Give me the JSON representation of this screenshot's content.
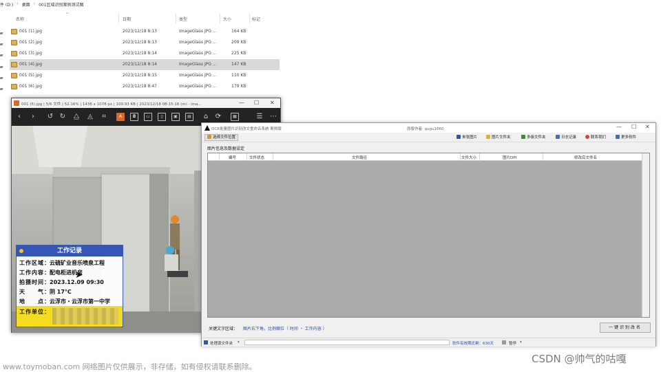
{
  "explorer": {
    "breadcrumb": [
      "件 (D:)",
      "桌面",
      "001区域识别案例测试图"
    ],
    "columns": {
      "name": "名称",
      "date": "日期",
      "type": "类型",
      "size": "大小",
      "tag": "标记"
    },
    "files": [
      {
        "name": "001 (1).jpg",
        "date": "2023/12/18 8:13",
        "type": "ImageGlass JPG ...",
        "size": "164 KB"
      },
      {
        "name": "001 (2).jpg",
        "date": "2023/12/18 8:13",
        "type": "ImageGlass JPG ...",
        "size": "209 KB"
      },
      {
        "name": "001 (3).jpg",
        "date": "2023/12/18 8:14",
        "type": "ImageGlass JPG ...",
        "size": "225 KB"
      },
      {
        "name": "001 (4).jpg",
        "date": "2023/12/18 8:14",
        "type": "ImageGlass JPG ...",
        "size": "147 KB"
      },
      {
        "name": "001 (5).jpg",
        "date": "2023/12/18 8:15",
        "type": "ImageGlass JPG ...",
        "size": "110 KB"
      },
      {
        "name": "001 (6).jpg",
        "date": "2023/12/18 8:47",
        "type": "ImageGlass JPG ...",
        "size": "179 KB"
      }
    ],
    "selected_index": 3
  },
  "viewer": {
    "title": "001 (5).jpg  |  5/6 文件  |  52.16%  |  1436 x 1078 px  |  109.93 KB  |  2023/12/18 08:15:16 (m)  -  ima...",
    "controls": {
      "minimize": "—",
      "maximize": "☐",
      "close": "✕"
    },
    "work_record": {
      "title": "工作记录",
      "rows": [
        {
          "key": "工作区域：",
          "value": "云硫矿业音乐喷泉工程"
        },
        {
          "key": "工作内容：",
          "value": "配电柜进机房"
        },
        {
          "key": "拍摄时间：",
          "value": "2023.12.09 09:30"
        },
        {
          "key": "天　　气：",
          "value": "阴 17°C"
        },
        {
          "key": "地　　点：",
          "value": "云浮市・云浮市第一中学"
        },
        {
          "key": "工作单位：",
          "value": ""
        }
      ]
    }
  },
  "ocr": {
    "title": "OCR批量图片识别改文重命名系统   案例版",
    "author": "原版作者: qugu1660",
    "controls": {
      "minimize": "—",
      "maximize": "☐",
      "close": "✕"
    },
    "select_location": "选择文件位置",
    "menu": [
      "单张图片",
      "图片文件夹",
      "多级文件夹",
      "日志记录",
      "联系我们",
      "更多软件"
    ],
    "menu_colors": [
      "#2c5aa0",
      "#e0b030",
      "#3d8a3d",
      "#4a6ea8",
      "#d04a3a",
      "#4a6ea8"
    ],
    "section": "图片信息及数据设定",
    "table_headers": [
      "编号",
      "文件状态",
      "文件路径",
      "文件大小",
      "图片DPI",
      "修改后文件名"
    ],
    "keyword_label": "关键文字区域：",
    "keyword_value": "图片右下角，比例缩位（ 时间 ・ 工作内容 ）",
    "run_button": "一键识别改名",
    "status_left": "处理源文件夹",
    "status_right": "软件有效期还剩：630天",
    "status_pause": "暂停"
  },
  "watermarks": {
    "left": "www.toymoban.com 网络图片仅供展示，非存储，如有侵权请联系删除。",
    "right": "CSDN @帅气的咕嘎"
  }
}
